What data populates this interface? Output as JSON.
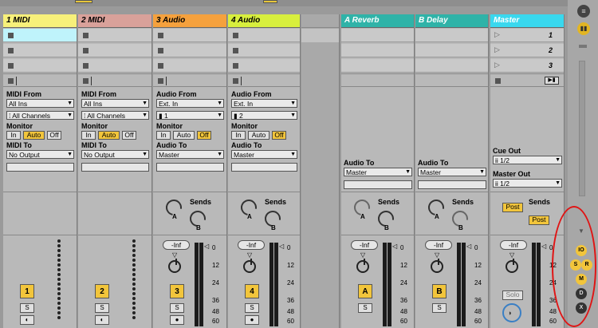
{
  "tracks": [
    {
      "id": "t1",
      "title": "1 MIDI",
      "color": "#f7f07a",
      "io_type": "midi",
      "from_label": "MIDI From",
      "from_value": "All Ins",
      "channel_value": "All Channels",
      "monitor_label": "Monitor",
      "monitor": [
        "In",
        "Auto",
        "Off"
      ],
      "monitor_active": "Auto",
      "to_label": "MIDI To",
      "to_value": "No Output",
      "number": "1",
      "solo": "S"
    },
    {
      "id": "t2",
      "title": "2 MIDI",
      "color": "#d9a19a",
      "io_type": "midi",
      "from_label": "MIDI From",
      "from_value": "All Ins",
      "channel_value": "All Channels",
      "monitor_label": "Monitor",
      "monitor": [
        "In",
        "Auto",
        "Off"
      ],
      "monitor_active": "Auto",
      "to_label": "MIDI To",
      "to_value": "No Output",
      "number": "2",
      "solo": "S"
    },
    {
      "id": "t3",
      "title": "3 Audio",
      "color": "#f5a13d",
      "io_type": "audio",
      "from_label": "Audio From",
      "from_value": "Ext. In",
      "channel_value": "1",
      "monitor_label": "Monitor",
      "monitor": [
        "In",
        "Auto",
        "Off"
      ],
      "monitor_active": "Off",
      "to_label": "Audio To",
      "to_value": "Master",
      "number": "3",
      "solo": "S",
      "sends_label": "Sends",
      "inf": "-Inf"
    },
    {
      "id": "t4",
      "title": "4 Audio",
      "color": "#d8ef3d",
      "io_type": "audio",
      "from_label": "Audio From",
      "from_value": "Ext. In",
      "channel_value": "2",
      "monitor_label": "Monitor",
      "monitor": [
        "In",
        "Auto",
        "Off"
      ],
      "monitor_active": "Off",
      "to_label": "Audio To",
      "to_value": "Master",
      "number": "4",
      "solo": "S",
      "sends_label": "Sends",
      "inf": "-Inf"
    }
  ],
  "returns": [
    {
      "id": "ra",
      "title": "A Reverb",
      "color": "#2fb3a8",
      "to_label": "Audio To",
      "to_value": "Master",
      "number": "A",
      "solo": "S",
      "sends_label": "Sends",
      "inf": "-Inf"
    },
    {
      "id": "rb",
      "title": "B Delay",
      "color": "#2fb3a8",
      "to_label": "Audio To",
      "to_value": "Master",
      "number": "B",
      "solo": "S",
      "sends_label": "Sends",
      "inf": "-Inf"
    }
  ],
  "master": {
    "title": "Master",
    "color": "#39d8ee",
    "scenes": [
      "1",
      "2",
      "3"
    ],
    "cue_label": "Cue Out",
    "cue_value": "1/2",
    "out_label": "Master Out",
    "out_value": "1/2",
    "post": "Post",
    "sends_label": "Sends",
    "inf": "-Inf",
    "solo": "Solo"
  },
  "knob_labels": {
    "a": "A",
    "b": "B"
  },
  "meter_ticks": [
    "0",
    "12",
    "24",
    "36",
    "48",
    "60"
  ],
  "sidebar": {
    "buttons": [
      "IO",
      "S",
      "R",
      "M",
      "D",
      "X"
    ]
  },
  "colors": {
    "accent": "#f2c53b",
    "highlight": "#e01414"
  }
}
